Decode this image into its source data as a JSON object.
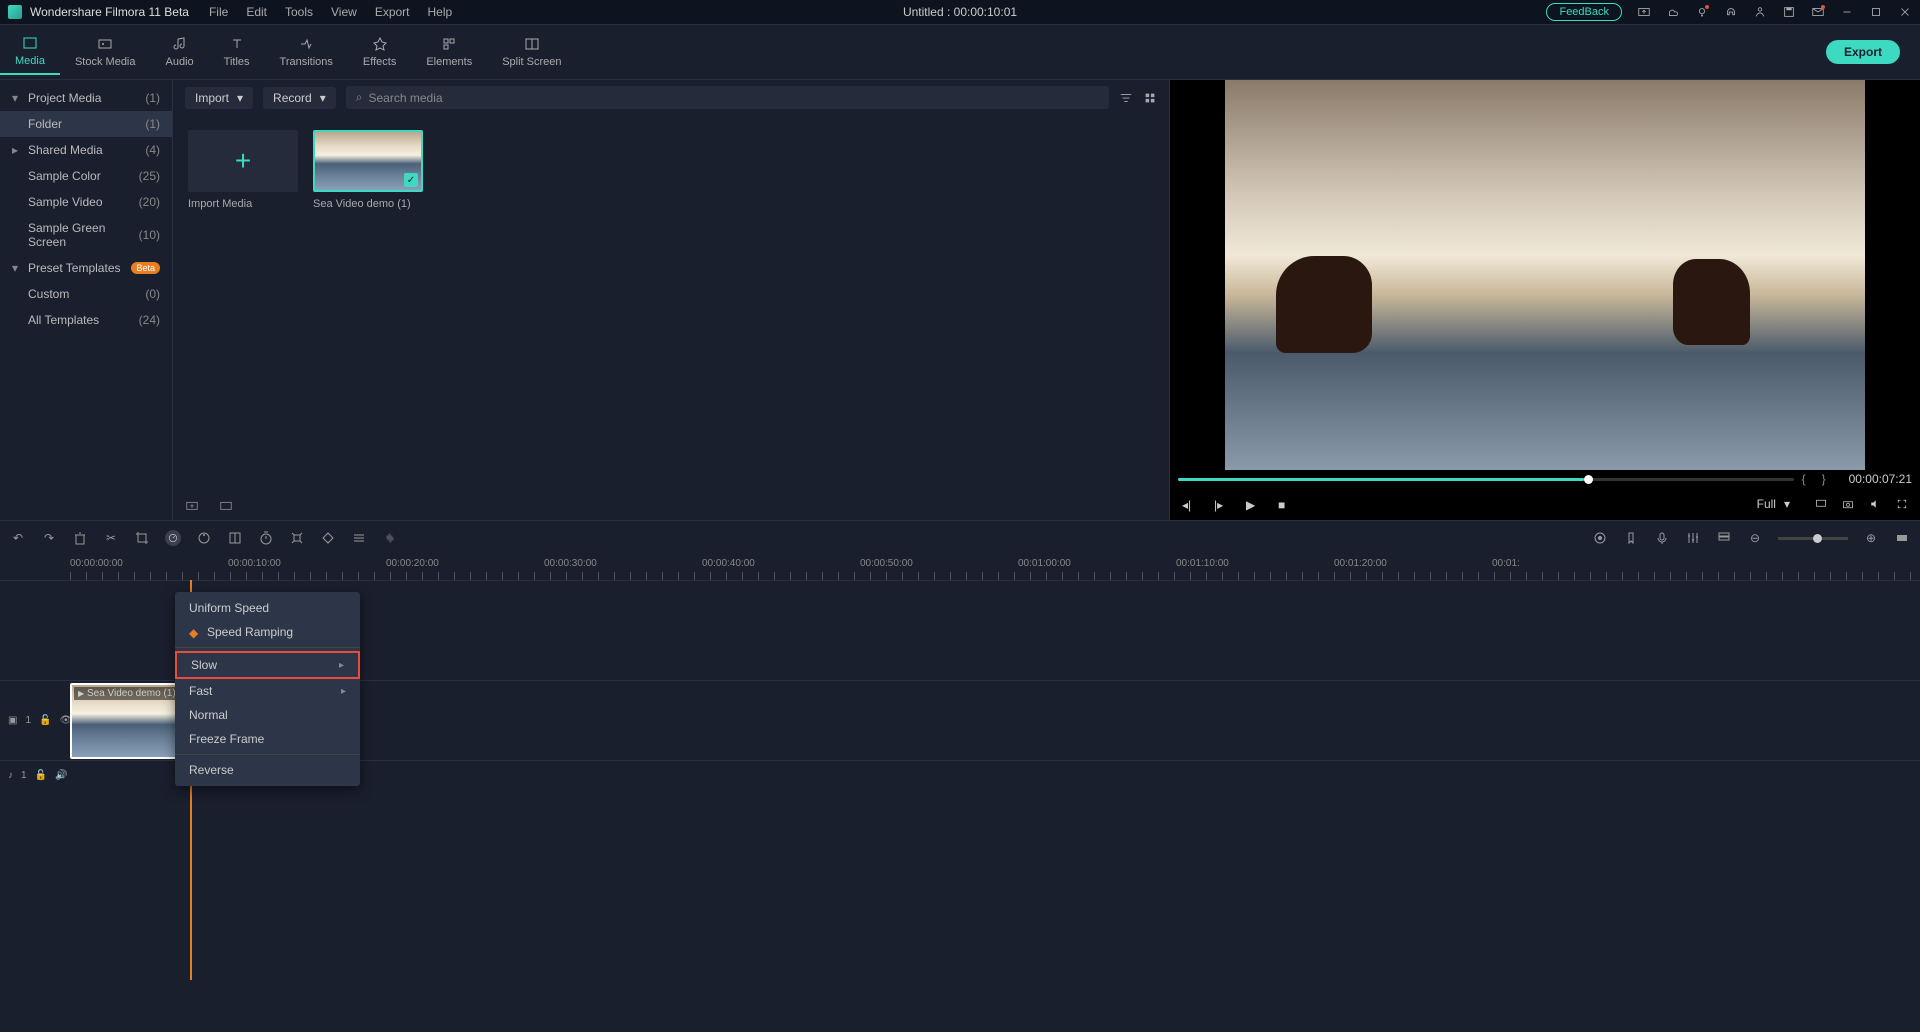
{
  "app": {
    "title": "Wondershare Filmora 11 Beta"
  },
  "menu": {
    "file": "File",
    "edit": "Edit",
    "tools": "Tools",
    "view": "View",
    "export": "Export",
    "help": "Help"
  },
  "document": {
    "title": "Untitled : 00:00:10:01"
  },
  "feedback": {
    "label": "FeedBack"
  },
  "tabs": {
    "media": "Media",
    "stock": "Stock Media",
    "audio": "Audio",
    "titles": "Titles",
    "transitions": "Transitions",
    "effects": "Effects",
    "elements": "Elements",
    "split": "Split Screen"
  },
  "export_btn": "Export",
  "sidebar": {
    "project_media": {
      "label": "Project Media",
      "count": "(1)"
    },
    "folder": {
      "label": "Folder",
      "count": "(1)"
    },
    "shared_media": {
      "label": "Shared Media",
      "count": "(4)"
    },
    "sample_color": {
      "label": "Sample Color",
      "count": "(25)"
    },
    "sample_video": {
      "label": "Sample Video",
      "count": "(20)"
    },
    "sample_green": {
      "label": "Sample Green Screen",
      "count": "(10)"
    },
    "preset_templates": {
      "label": "Preset Templates",
      "badge": "Beta"
    },
    "custom": {
      "label": "Custom",
      "count": "(0)"
    },
    "all_templates": {
      "label": "All Templates",
      "count": "(24)"
    }
  },
  "media_toolbar": {
    "import": "Import",
    "record": "Record",
    "search_placeholder": "Search media"
  },
  "media_items": {
    "import": "Import Media",
    "clip1": "Sea Video demo (1)"
  },
  "preview": {
    "timecode": "00:00:07:21",
    "quality": "Full",
    "marker_in": "{",
    "marker_out": "}"
  },
  "timeline": {
    "marks": [
      "00:00:00:00",
      "00:00:10:00",
      "00:00:20:00",
      "00:00:30:00",
      "00:00:40:00",
      "00:00:50:00",
      "00:01:00:00",
      "00:01:10:00",
      "00:01:20:00",
      "00:01:"
    ],
    "video_track": "1",
    "audio_track": "1",
    "clip_label": "Sea Video demo (1)"
  },
  "context_menu": {
    "uniform_speed": "Uniform Speed",
    "speed_ramping": "Speed Ramping",
    "slow": "Slow",
    "fast": "Fast",
    "normal": "Normal",
    "freeze": "Freeze Frame",
    "reverse": "Reverse"
  }
}
